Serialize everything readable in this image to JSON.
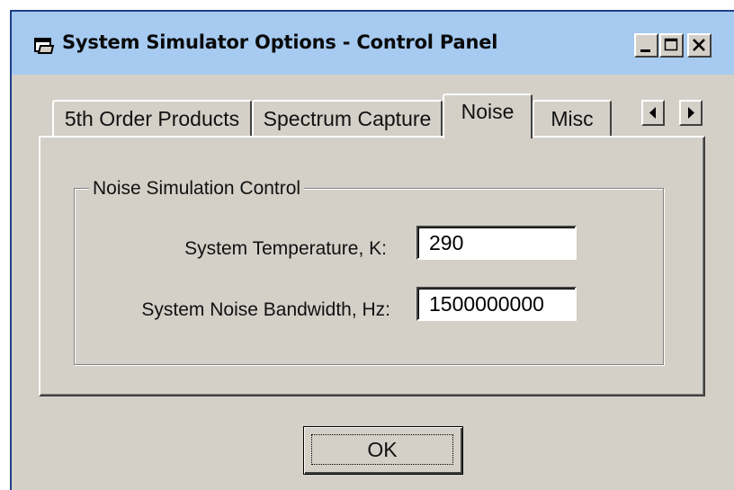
{
  "window": {
    "title": "System Simulator Options - Control Panel",
    "title_bar_color": "#a6caf0",
    "face_color": "#d4d0c8",
    "icons": {
      "app": "folder-options-icon",
      "minimize": "minimize-icon",
      "maximize": "maximize-icon",
      "close": "close-icon"
    }
  },
  "tabs": [
    {
      "label": "5th Order Products",
      "active": false
    },
    {
      "label": "Spectrum Capture",
      "active": false
    },
    {
      "label": "Noise",
      "active": true
    },
    {
      "label": "Misc",
      "active": false
    }
  ],
  "tab_scroll": {
    "left_icon": "arrow-left-icon",
    "right_icon": "arrow-right-icon"
  },
  "noise_group": {
    "title": "Noise Simulation Control",
    "temperature": {
      "label": "System Temperature, K:",
      "value": "290"
    },
    "bandwidth": {
      "label": "System Noise Bandwidth, Hz:",
      "value": "1500000000"
    }
  },
  "buttons": {
    "ok_label": "OK"
  }
}
